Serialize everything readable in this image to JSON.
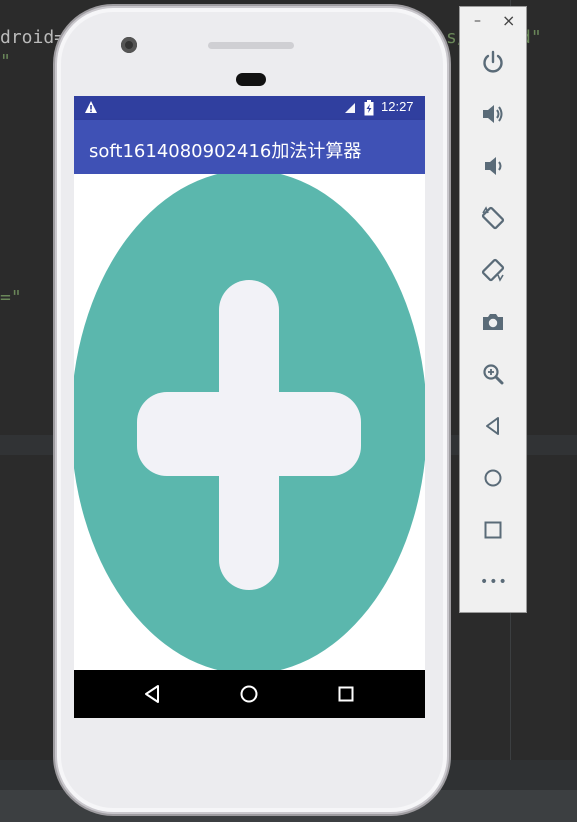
{
  "ide": {
    "line1": "droid=\"",
    "line1_tail": "s/",
    "line1_end": "d\"",
    "line2": "\"",
    "line3": "=\""
  },
  "status_bar": {
    "time": "12:27",
    "warning_icon": "warning-icon",
    "signal_icon": "signal-icon",
    "battery_icon": "battery-charging-icon"
  },
  "app_bar": {
    "title": "soft1614080902416加法计算器"
  },
  "content": {
    "image": "plus-sign-image",
    "colors": {
      "oval": "#5bb7ad",
      "plus": "#f2f2f7"
    }
  },
  "nav_bar": {
    "back_icon": "back-triangle-icon",
    "home_icon": "home-circle-icon",
    "recents_icon": "recents-square-icon"
  },
  "emulator_panel": {
    "minimize": "–",
    "close": "×",
    "tools": [
      {
        "name": "power-icon"
      },
      {
        "name": "volume-up-icon"
      },
      {
        "name": "volume-down-icon"
      },
      {
        "name": "rotate-left-icon"
      },
      {
        "name": "rotate-right-icon"
      },
      {
        "name": "camera-icon"
      },
      {
        "name": "zoom-icon"
      },
      {
        "name": "back-icon"
      },
      {
        "name": "home-icon"
      },
      {
        "name": "overview-icon"
      },
      {
        "name": "more-icon"
      }
    ],
    "more_label": "•••"
  },
  "colors": {
    "status_bar": "#303f9f",
    "app_bar": "#3f51b5",
    "ide_bg": "#2b2b2b"
  }
}
